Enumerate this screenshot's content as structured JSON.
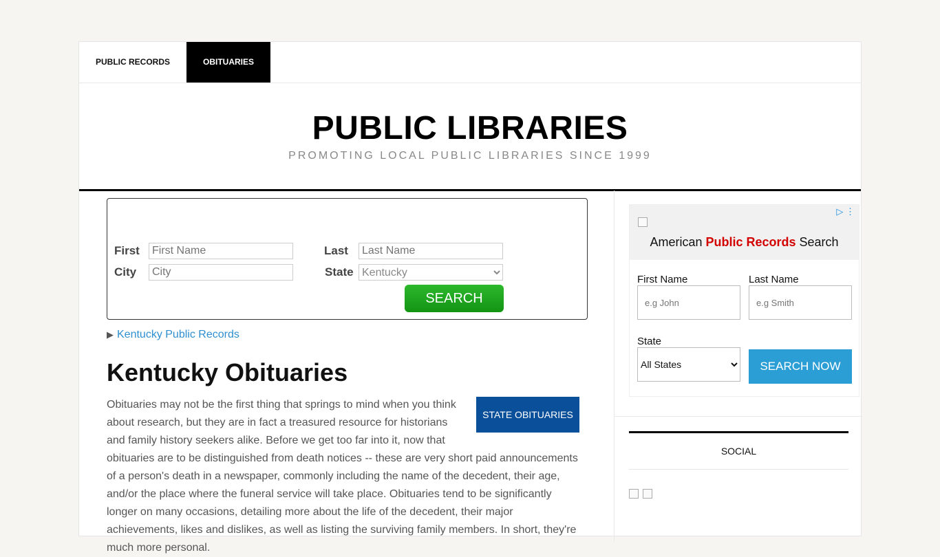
{
  "nav": {
    "items": [
      "PUBLIC RECORDS",
      "OBITUARIES"
    ],
    "active": "OBITUARIES"
  },
  "header": {
    "title": "PUBLIC LIBRARIES",
    "tagline": "PROMOTING LOCAL PUBLIC LIBRARIES SINCE 1999"
  },
  "search": {
    "first_label": "First",
    "first_placeholder": "First Name",
    "last_label": "Last",
    "last_placeholder": "Last Name",
    "city_label": "City",
    "city_placeholder": "City",
    "state_label": "State",
    "state_value": "Kentucky",
    "button": "SEARCH"
  },
  "records_link": "Kentucky Public Records",
  "page_title": "Kentucky Obituaries",
  "state_obits_button": "STATE OBITUARIES",
  "body_text": "Obituaries may not be the first thing that springs to mind when you think about research, but they are in fact a treasured resource for historians and family history seekers alike. Before we get too far into it, now that obituaries are to be distinguished from death notices -- these are very short paid announcements of a person's death in a newspaper, commonly including the name of the decedent, their age, and/or the place where the funeral service will take place. Obituaries tend to be significantly longer on many occasions, detailing more about the life of the decedent, their major achievements, likes and dislikes, as well as listing the surviving family members. In short, they're much more personal.",
  "ad": {
    "title_pre": "American ",
    "title_red": "Public Records",
    "title_post": " Search",
    "first_label": "First Name",
    "first_placeholder": "e.g John",
    "last_label": "Last Name",
    "last_placeholder": "e.g Smith",
    "state_label": "State",
    "state_value": "All States",
    "button": "SEARCH NOW"
  },
  "social": {
    "title": "SOCIAL"
  },
  "colors": {
    "search_green": "#139413",
    "state_btn_blue": "#0a4f99",
    "ad_btn_blue": "#2b9ed6",
    "link_blue": "#2e8fd0",
    "ad_red": "#d20000"
  }
}
